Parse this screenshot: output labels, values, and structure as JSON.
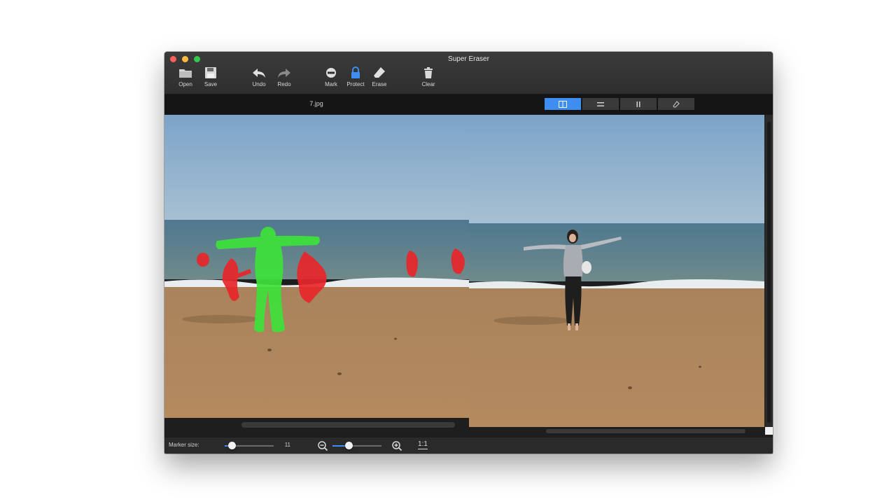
{
  "window": {
    "title": "Super Eraser"
  },
  "toolbar": {
    "open": "Open",
    "save": "Save",
    "undo": "Undo",
    "redo": "Redo",
    "mark": "Mark",
    "protect": "Protect",
    "erase": "Erase",
    "clear": "Clear"
  },
  "document": {
    "filename": "7.jpg"
  },
  "view_modes": [
    "side-by-side-icon",
    "horizontal-split-icon",
    "vertical-split-icon",
    "eraser-view-icon"
  ],
  "view_mode_selected": 0,
  "bottom": {
    "marker_size_label": "Marker size:",
    "marker_size_value": "11",
    "zoom_actual": "1:1"
  },
  "colors": {
    "accent": "#3d8ef0",
    "mark_red": "#e8262a",
    "protect_green": "#3de23a"
  }
}
